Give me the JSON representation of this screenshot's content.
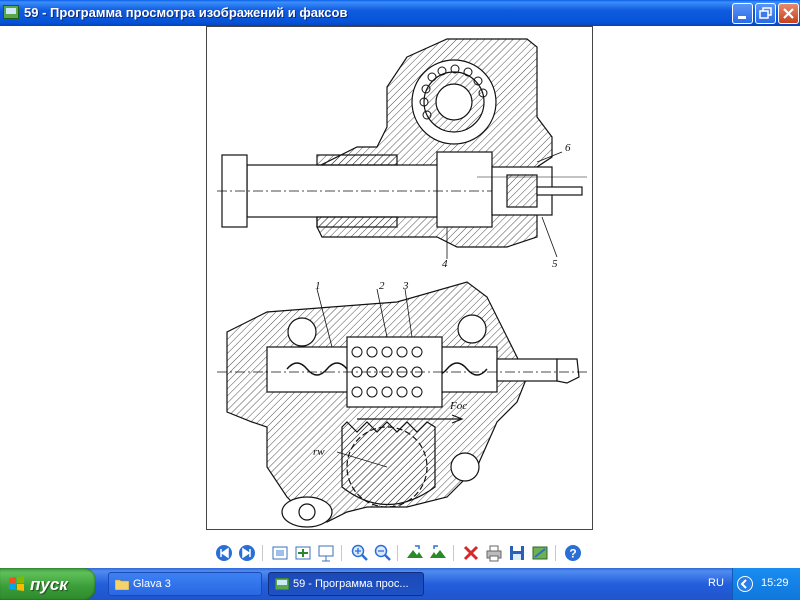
{
  "window": {
    "title": "59 - Программа просмотра изображений и факсов",
    "controls": [
      "minimize-icon",
      "restore-icon",
      "close-icon"
    ]
  },
  "drawing": {
    "labels": {
      "l1": "1",
      "l2": "2",
      "l3": "3",
      "l4": "4",
      "l5": "5",
      "l6": "6",
      "force": "Fос",
      "radius": "rw"
    }
  },
  "toolbar": {
    "buttons": [
      "previous-image-icon",
      "next-image-icon",
      "best-fit-icon",
      "actual-size-icon",
      "slideshow-icon",
      "zoom-in-icon",
      "zoom-out-icon",
      "rotate-clockwise-icon",
      "rotate-counterclockwise-icon",
      "delete-icon",
      "print-icon",
      "save-icon",
      "edit-icon",
      "help-icon"
    ]
  },
  "taskbar": {
    "start_label": "пуск",
    "tasks": [
      {
        "label": "Glava 3",
        "icon": "folder-icon",
        "active": false
      },
      {
        "label": "59 - Программа прос...",
        "icon": "image-viewer-icon",
        "active": true
      }
    ],
    "language": "RU",
    "clock": "15:29"
  },
  "colors": {
    "titlebar": "#0552d6",
    "taskbar": "#245edb",
    "start_button": "#3a9c38",
    "tray": "#0f77dc"
  }
}
